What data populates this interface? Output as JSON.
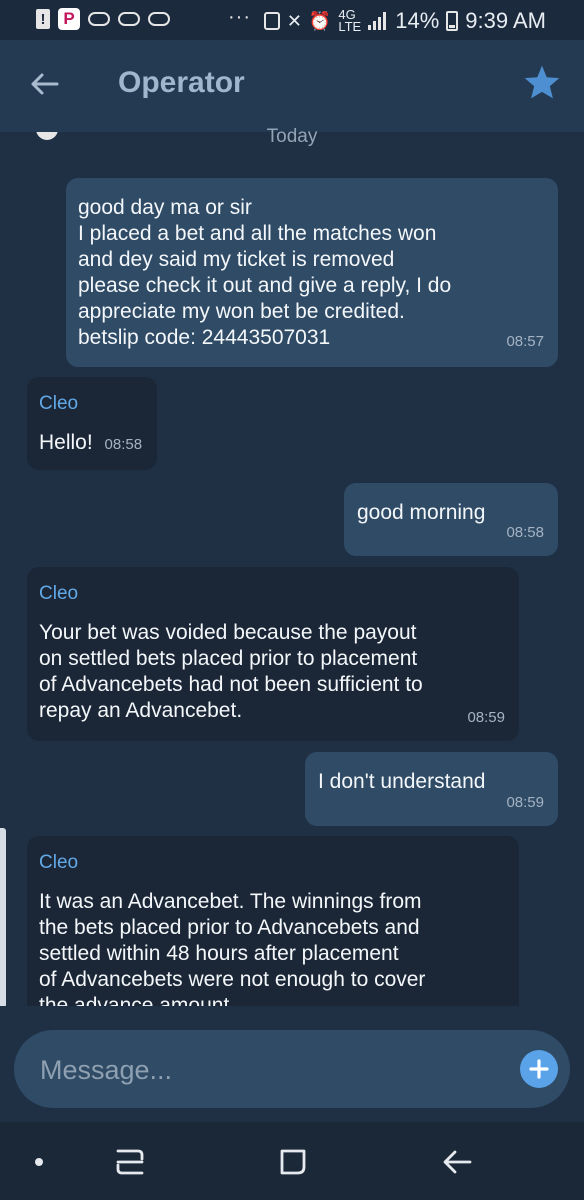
{
  "status_bar": {
    "net": "4G",
    "lte": "LTE",
    "battery": "14%",
    "time": "9:39 AM",
    "overflow": "···"
  },
  "header": {
    "title": "Operator",
    "back_icon": "arrow-left-icon",
    "star_icon": "star-icon"
  },
  "chat": {
    "date_separator": "Today",
    "messages": [
      {
        "direction": "outgoing",
        "text": "good day ma or sir\nI placed a bet and all the matches won\nand dey said my ticket is removed\nplease check it out and give a reply,  I do\nappreciate my won bet be credited.\nbetslip code: 24443507031",
        "time": "08:57"
      },
      {
        "direction": "incoming",
        "sender": "Cleo",
        "text": "Hello!",
        "time": "08:58"
      },
      {
        "direction": "outgoing",
        "text": "good morning",
        "time": "08:58"
      },
      {
        "direction": "incoming",
        "sender": "Cleo",
        "text": "Your bet was voided because the payout\non settled bets placed prior to placement\nof Advancebets had not been sufficient to\nrepay an Advancebet.",
        "time": "08:59"
      },
      {
        "direction": "outgoing",
        "text": "I don't understand",
        "time": "08:59"
      },
      {
        "direction": "incoming",
        "sender": "Cleo",
        "text": "It was an Advancebet. The winnings from\nthe bets placed prior to Advancebets and\nsettled within 48 hours after placement\nof Advancebets were not enough to cover\nthe advance amount.",
        "time": ""
      }
    ]
  },
  "composer": {
    "placeholder": "Message...",
    "add_icon": "plus-icon"
  },
  "colors": {
    "background": "#1f3045",
    "header": "#243a52",
    "outgoing_bubble": "#2f4b66",
    "incoming_bubble": "#1b2737",
    "sender": "#62a9e7",
    "accent": "#5aa3e8"
  }
}
